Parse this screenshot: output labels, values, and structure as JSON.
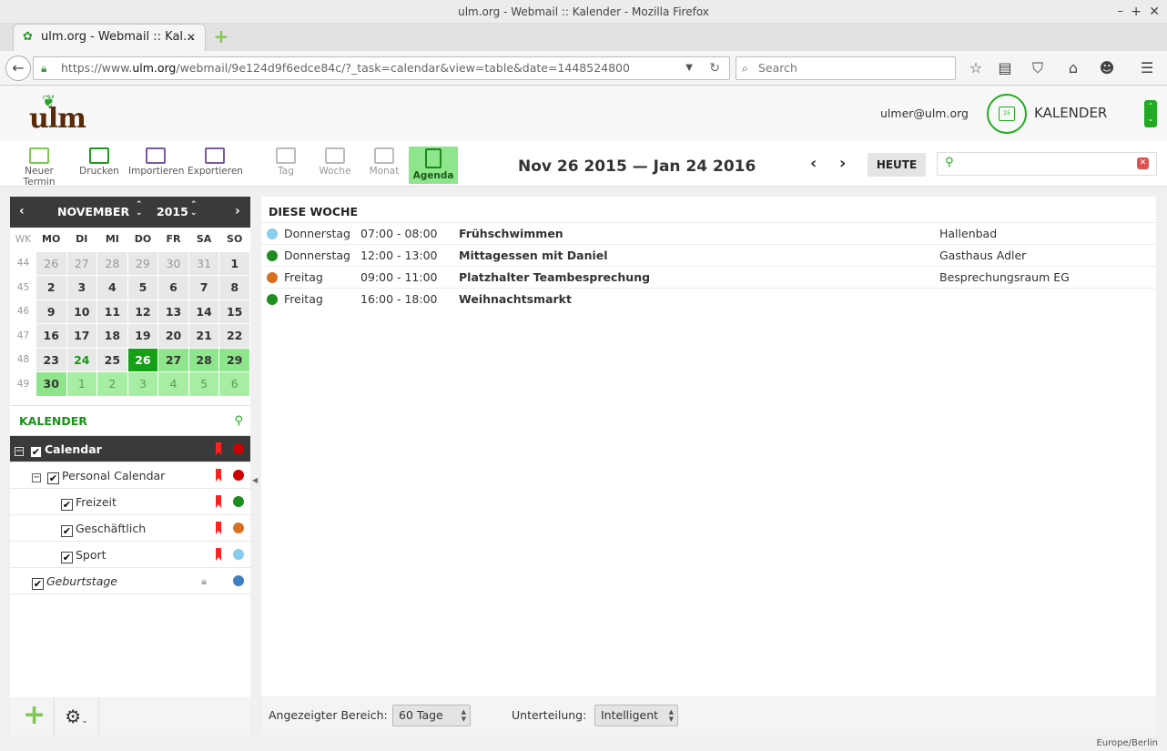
{
  "browser": {
    "window_title": "ulm.org - Webmail :: Kalender - Mozilla Firefox",
    "tab_title": "ulm.org - Webmail :: Kal...",
    "url_prefix": "https://www.",
    "url_domain": "ulm.org",
    "url_path": "/webmail/9e124d9f6edce84c/?_task=calendar&view=table&date=1448524800",
    "search_placeholder": "Search"
  },
  "header": {
    "logo_text": "ulm",
    "user": "ulmer@ulm.org",
    "app_label": "KALENDER",
    "app_icon_day": "15"
  },
  "toolbar": {
    "new_event": "Neuer Termin",
    "print": "Drucken",
    "import": "Importieren",
    "export": "Exportieren",
    "day": "Tag",
    "week": "Woche",
    "month": "Monat",
    "agenda": "Agenda",
    "date_range": "Nov 26 2015 — Jan 24 2016",
    "today": "HEUTE"
  },
  "minical": {
    "month": "NOVEMBER",
    "year": "2015",
    "headers": [
      "WK",
      "MO",
      "DI",
      "MI",
      "DO",
      "FR",
      "SA",
      "SO"
    ]
  },
  "calendars": {
    "heading": "KALENDER",
    "items": [
      {
        "label": "Calendar",
        "color": "#cc0000"
      },
      {
        "label": "Personal Calendar",
        "color": "#cc0000"
      },
      {
        "label": "Freizeit",
        "color": "#1e8c1e"
      },
      {
        "label": "Geschäftlich",
        "color": "#d87020"
      },
      {
        "label": "Sport",
        "color": "#88ccee"
      },
      {
        "label": "Geburtstage",
        "color": "#3f7fbf"
      }
    ]
  },
  "agenda": {
    "section": "DIESE WOCHE",
    "events": [
      {
        "day": "Donnerstag",
        "time": "07:00 - 08:00",
        "title": "Frühschwimmen",
        "location": "Hallenbad",
        "color": "#88ccee"
      },
      {
        "day": "Donnerstag",
        "time": "12:00 - 13:00",
        "title": "Mittagessen mit Daniel",
        "location": "Gasthaus Adler",
        "color": "#1e8c1e"
      },
      {
        "day": "Freitag",
        "time": "09:00 - 11:00",
        "title": "Platzhalter Teambesprechung",
        "location": "Besprechungsraum EG",
        "color": "#d87020"
      },
      {
        "day": "Freitag",
        "time": "16:00 - 18:00",
        "title": "Weihnachtsmarkt",
        "location": "",
        "color": "#1e8c1e"
      }
    ]
  },
  "footer": {
    "range_label": "Angezeigter Bereich:",
    "range_value": "60 Tage",
    "division_label": "Unterteilung:",
    "division_value": "Intelligent",
    "timezone": "Europe/Berlin"
  }
}
